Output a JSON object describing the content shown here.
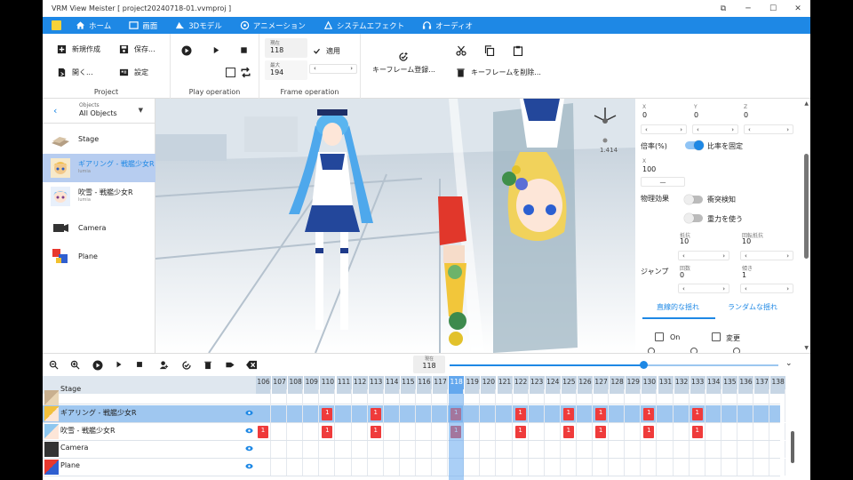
{
  "window": {
    "title": "VRM View Meister [ project20240718-01.vvmproj ]"
  },
  "menu": [
    {
      "label": "ホーム",
      "icon": "home-icon"
    },
    {
      "label": "画面",
      "icon": "screen-icon"
    },
    {
      "label": "3Dモデル",
      "icon": "model-icon"
    },
    {
      "label": "アニメーション",
      "icon": "animation-icon"
    },
    {
      "label": "システムエフェクト",
      "icon": "effect-icon"
    },
    {
      "label": "オーディオ",
      "icon": "headphones-icon"
    }
  ],
  "ribbon": {
    "project": {
      "new": "新規作成",
      "save": "保存...",
      "open": "開く...",
      "settings": "設定",
      "label": "Project"
    },
    "play": {
      "label": "Play operation"
    },
    "frame": {
      "current_caption": "現在",
      "current_value": "118",
      "max_caption": "最大",
      "max_value": "194",
      "apply": "適用",
      "label": "Frame operation"
    },
    "keyframe": {
      "register": "キーフレーム登録...",
      "delete": "キーフレームを削除..."
    }
  },
  "objects": {
    "caption": "Objects",
    "selected": "All Objects",
    "items": [
      {
        "name": "Stage",
        "sub": ""
      },
      {
        "name": "ギアリング - 戦艦少女R",
        "sub": "lumia"
      },
      {
        "name": "吹雪 - 戦艦少女R",
        "sub": "lumia"
      },
      {
        "name": "Camera",
        "sub": ""
      },
      {
        "name": "Plane",
        "sub": ""
      }
    ]
  },
  "viewport": {
    "gizmo_value": "1.414"
  },
  "properties": {
    "x_cap": "X",
    "y_cap": "Y",
    "z_cap": "Z",
    "x": "0",
    "y": "0",
    "z": "0",
    "scale_label": "倍率(%)",
    "keep_ratio": "比率を固定",
    "scale_x_cap": "X",
    "scale_x": "100",
    "minus": "—",
    "physics": "物理効果",
    "collision": "衝突検知",
    "gravity": "重力を使う",
    "resist_cap": "抵抗",
    "resist": "10",
    "rot_resist_cap": "回転抵抗",
    "rot_resist": "10",
    "jump": "ジャンプ",
    "times_cap": "回数",
    "times": "0",
    "slope_cap": "傾き",
    "slope": "1",
    "tab_linear": "直線的な揺れ",
    "tab_random": "ランダムな揺れ",
    "on": "On",
    "change": "変更"
  },
  "timeline": {
    "current_caption": "現在",
    "current_value": "118",
    "progress": 0.59,
    "frames": [
      "106",
      "107",
      "108",
      "109",
      "110",
      "111",
      "112",
      "113",
      "114",
      "115",
      "116",
      "117",
      "118",
      "119",
      "120",
      "121",
      "122",
      "123",
      "124",
      "125",
      "126",
      "127",
      "128",
      "129",
      "130",
      "131",
      "132",
      "133",
      "134",
      "135",
      "136",
      "137",
      "138"
    ],
    "current_frame": "118",
    "rows": [
      {
        "name": "Stage",
        "keys": []
      },
      {
        "name": "ギアリング - 戦艦少女R",
        "keys": [
          "110",
          "113",
          "118",
          "122",
          "125",
          "127",
          "130",
          "133"
        ]
      },
      {
        "name": "吹雪 - 戦艦少女R",
        "keys": [
          "106",
          "110",
          "113",
          "118",
          "122",
          "125",
          "127",
          "130",
          "133"
        ]
      },
      {
        "name": "Camera",
        "keys": []
      },
      {
        "name": "Plane",
        "keys": []
      }
    ],
    "key_label": "1"
  }
}
